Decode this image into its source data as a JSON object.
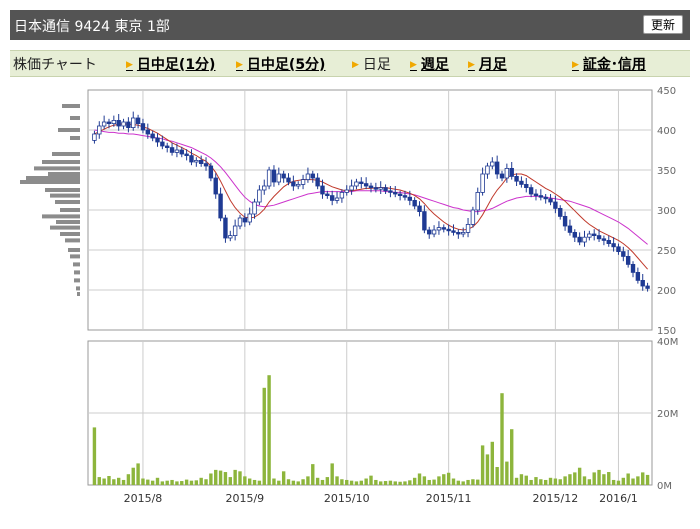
{
  "header": {
    "title": "日本通信  9424  東京 1部",
    "refresh_label": "更新"
  },
  "nav": {
    "label": "株価チャート",
    "items": [
      {
        "label": "日中足(1分)",
        "active": true
      },
      {
        "label": "日中足(5分)",
        "active": true
      },
      {
        "label": "日足",
        "active": false
      },
      {
        "label": "週足",
        "active": true
      },
      {
        "label": "月足",
        "active": true
      },
      {
        "label": "証金･信用",
        "active": true
      }
    ]
  },
  "colors": {
    "candle": "#1f3a93",
    "ma_short": "#c0392b",
    "ma_long": "#cc33cc",
    "volume": "#8db53c",
    "volume_profile": "#8c8c8c",
    "grid": "#cccccc"
  },
  "chart_data": [
    {
      "type": "candlestick",
      "ylim": [
        150,
        450
      ],
      "yticks": [
        "450",
        "400",
        "350",
        "300",
        "250",
        "200",
        "150"
      ],
      "x_labels": [
        "2015/8",
        "2015/9",
        "2015/10",
        "2015/11",
        "2015/12",
        "2016/1"
      ],
      "close": [
        395,
        405,
        410,
        408,
        412,
        405,
        410,
        403,
        415,
        408,
        400,
        395,
        390,
        385,
        380,
        378,
        372,
        375,
        370,
        368,
        360,
        362,
        358,
        355,
        340,
        320,
        290,
        265,
        268,
        280,
        290,
        285,
        295,
        310,
        325,
        330,
        350,
        335,
        345,
        340,
        335,
        330,
        332,
        338,
        345,
        340,
        330,
        320,
        318,
        312,
        315,
        322,
        325,
        330,
        335,
        333,
        330,
        328,
        326,
        328,
        324,
        322,
        320,
        318,
        316,
        312,
        305,
        298,
        275,
        270,
        275,
        278,
        276,
        274,
        272,
        270,
        272,
        282,
        300,
        322,
        345,
        355,
        360,
        345,
        340,
        352,
        342,
        336,
        332,
        328,
        320,
        318,
        316,
        314,
        310,
        302,
        292,
        280,
        272,
        266,
        260,
        266,
        270,
        268,
        264,
        262,
        258,
        254,
        248,
        242,
        232,
        222,
        212,
        205,
        202
      ],
      "ma_short": [
        395,
        398,
        401,
        404,
        406,
        407,
        408,
        407,
        407,
        406,
        404,
        402,
        399,
        396,
        392,
        388,
        384,
        381,
        378,
        375,
        371,
        368,
        364,
        361,
        355,
        347,
        336,
        324,
        312,
        303,
        296,
        291,
        290,
        291,
        295,
        301,
        310,
        317,
        323,
        329,
        333,
        336,
        337,
        338,
        338,
        338,
        337,
        335,
        332,
        329,
        327,
        325,
        324,
        324,
        325,
        326,
        327,
        327,
        328,
        328,
        328,
        327,
        326,
        325,
        323,
        321,
        318,
        314,
        308,
        301,
        295,
        290,
        285,
        281,
        278,
        276,
        275,
        276,
        279,
        285,
        294,
        305,
        316,
        325,
        332,
        340,
        344,
        345,
        345,
        343,
        339,
        335,
        331,
        327,
        324,
        320,
        316,
        311,
        305,
        299,
        293,
        287,
        282,
        278,
        274,
        271,
        268,
        265,
        262,
        258,
        253,
        247,
        240,
        233,
        226
      ],
      "ma_long": [
        400,
        399,
        398,
        397,
        397,
        396,
        396,
        395,
        395,
        394,
        393,
        392,
        391,
        390,
        389,
        387,
        386,
        384,
        382,
        380,
        378,
        375,
        372,
        369,
        365,
        360,
        354,
        347,
        339,
        331,
        323,
        316,
        311,
        307,
        305,
        304,
        305,
        306,
        308,
        310,
        312,
        314,
        316,
        318,
        320,
        321,
        322,
        323,
        323,
        323,
        323,
        323,
        323,
        323,
        324,
        324,
        324,
        324,
        324,
        324,
        323,
        323,
        322,
        322,
        321,
        320,
        319,
        317,
        315,
        313,
        311,
        309,
        307,
        305,
        303,
        302,
        300,
        299,
        298,
        298,
        299,
        300,
        302,
        305,
        308,
        311,
        313,
        315,
        316,
        317,
        317,
        317,
        317,
        316,
        315,
        314,
        313,
        312,
        311,
        309,
        307,
        305,
        303,
        300,
        297,
        294,
        291,
        288,
        285,
        281,
        277,
        272,
        267,
        262,
        257
      ]
    },
    {
      "type": "bar",
      "ylim": [
        0,
        40
      ],
      "yticks": [
        "40M",
        "20M",
        "0M"
      ],
      "values": [
        16.0,
        2.2,
        1.8,
        2.5,
        1.6,
        2.0,
        1.4,
        3.0,
        4.8,
        6.0,
        1.8,
        1.5,
        1.2,
        2.0,
        1.0,
        1.2,
        1.4,
        1.0,
        1.1,
        1.5,
        1.2,
        1.3,
        2.0,
        1.6,
        3.2,
        4.2,
        4.0,
        3.6,
        2.2,
        4.2,
        3.8,
        2.4,
        1.8,
        1.4,
        1.2,
        27.0,
        30.5,
        1.8,
        1.2,
        3.8,
        1.6,
        1.2,
        1.0,
        1.6,
        2.4,
        5.8,
        2.0,
        1.4,
        2.2,
        6.0,
        2.4,
        1.6,
        1.4,
        1.2,
        1.0,
        1.2,
        1.8,
        2.6,
        1.4,
        1.0,
        1.1,
        1.2,
        1.0,
        0.9,
        1.0,
        1.3,
        2.0,
        3.2,
        2.4,
        1.4,
        1.5,
        2.4,
        3.0,
        3.4,
        1.8,
        1.2,
        1.0,
        1.4,
        1.6,
        1.5,
        11.0,
        8.5,
        12.0,
        5.0,
        25.5,
        6.5,
        15.5,
        2.0,
        3.0,
        2.6,
        1.4,
        2.2,
        1.6,
        1.4,
        2.0,
        1.8,
        1.6,
        2.4,
        3.0,
        3.5,
        4.8,
        2.4,
        1.6,
        3.5,
        4.2,
        3.0,
        3.6,
        1.4,
        1.2,
        2.0,
        3.2,
        1.8,
        2.4,
        3.5,
        2.8
      ]
    }
  ]
}
